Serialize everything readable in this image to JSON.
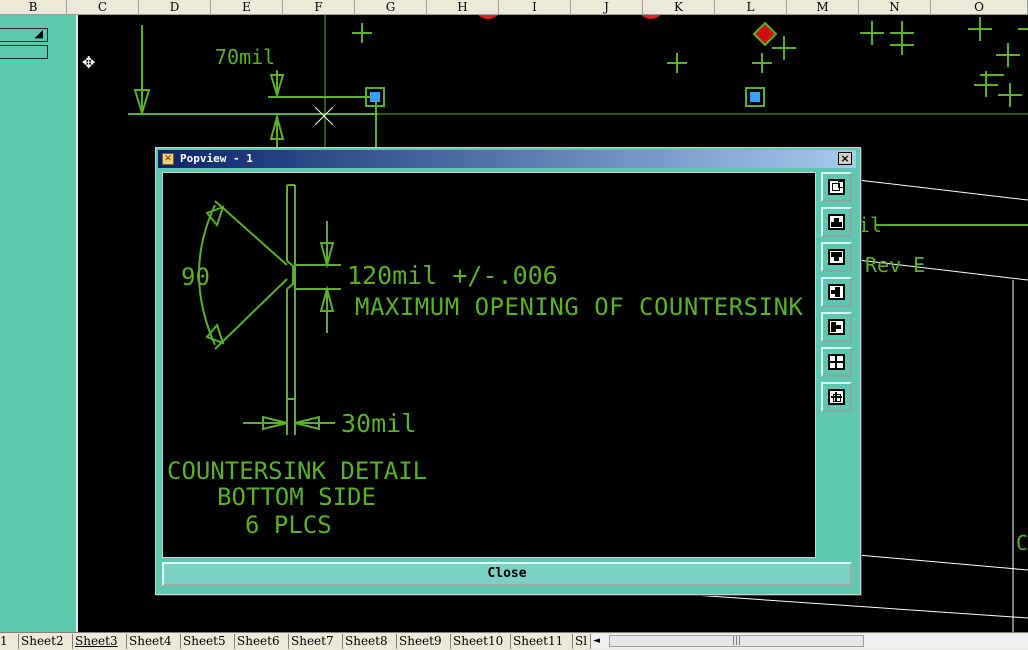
{
  "columns": [
    "B",
    "C",
    "D",
    "E",
    "F",
    "G",
    "H",
    "I",
    "J",
    "K",
    "L",
    "M",
    "N",
    "O"
  ],
  "canvas": {
    "dim_label": "70mil",
    "partial_label_1": "il",
    "partial_label_2": "Rev E",
    "partial_label_3": "C"
  },
  "popview": {
    "title": "Popview - 1",
    "close_x": "×",
    "title_icon": "✕",
    "close_button": "Close",
    "drawing": {
      "angle": "90",
      "opening_dim": "120mil +/-.006",
      "opening_note": "MAXIMUM OPENING OF COUNTERSINK",
      "thickness_dim": "30mil",
      "detail_title": "COUNTERSINK DETAIL",
      "detail_side": "BOTTOM SIDE",
      "detail_count": "6 PLCS"
    },
    "toolbar": [
      "zoom-window-icon",
      "pan-up-icon",
      "pan-down-icon",
      "pan-left-icon",
      "pan-right-icon",
      "zoom-in-icon",
      "zoom-out-icon"
    ]
  },
  "sheet_tabs": [
    "1",
    "Sheet2",
    "Sheet3",
    "Sheet4",
    "Sheet5",
    "Sheet6",
    "Sheet7",
    "Sheet8",
    "Sheet9",
    "Sheet10",
    "Sheet11",
    "Sl"
  ],
  "scroll_grip": "|||",
  "scroll_arrow": "◄",
  "colors": {
    "cad_green": "#5bb02a",
    "panel_teal": "#5cc8b0",
    "canvas_bg": "#000000"
  }
}
